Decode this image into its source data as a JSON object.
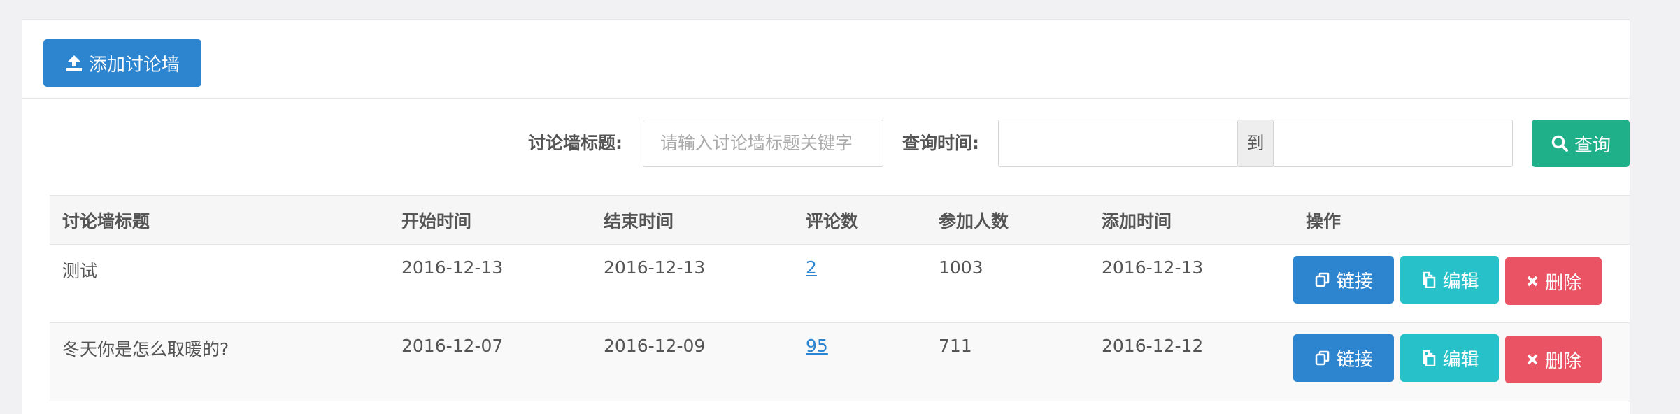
{
  "toolbar": {
    "add_label": "添加讨论墙"
  },
  "filters": {
    "title_label": "讨论墙标题:",
    "title_placeholder": "请输入讨论墙标题关键字",
    "time_label": "查询时间:",
    "range_sep": "到",
    "search_label": "查询"
  },
  "table": {
    "headers": [
      "讨论墙标题",
      "开始时间",
      "结束时间",
      "评论数",
      "参加人数",
      "添加时间",
      "操作"
    ],
    "rows": [
      {
        "title": "测试",
        "start": "2016-12-13",
        "end": "2016-12-13",
        "comments": "2",
        "participants": "1003",
        "added": "2016-12-13"
      },
      {
        "title": "冬天你是怎么取暖的?",
        "start": "2016-12-07",
        "end": "2016-12-09",
        "comments": "95",
        "participants": "711",
        "added": "2016-12-12"
      }
    ],
    "actions": {
      "link": "链接",
      "edit": "编辑",
      "delete": "删除"
    }
  },
  "colors": {
    "primary": "#2d84cf",
    "success": "#1fb08a",
    "info": "#26c1c9",
    "danger": "#ea5363"
  }
}
